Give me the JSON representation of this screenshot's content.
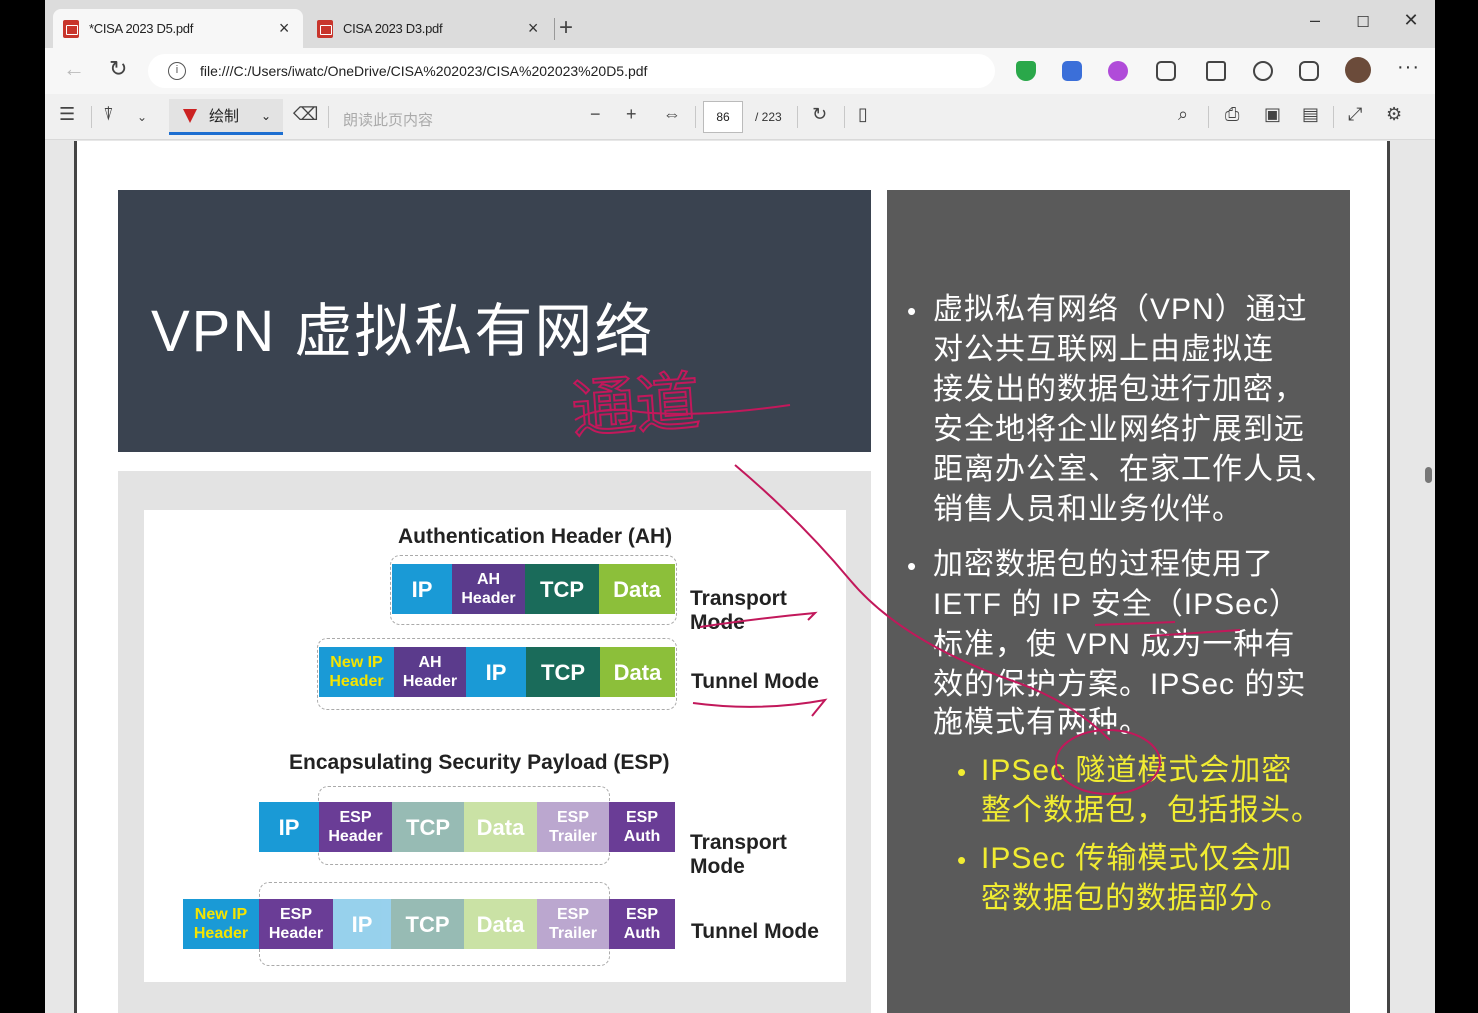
{
  "browser": {
    "tabs": [
      {
        "title": "*CISA 2023 D5.pdf",
        "close": "×"
      },
      {
        "title": "CISA 2023 D3.pdf",
        "close": "×"
      }
    ],
    "new_tab": "+",
    "window_controls": [
      "–",
      "☐",
      "✕"
    ],
    "url": "file:///C:/Users/iwatc/OneDrive/CISA%202023/CISA%202023%20D5.pdf",
    "info_glyph": "i",
    "more": "···"
  },
  "pdf_toolbar": {
    "draw_label": "绘制",
    "read_aloud": "朗读此页内容",
    "zoom_out": "−",
    "zoom_in": "+",
    "page_current": "86",
    "page_total": "/ 223"
  },
  "slide": {
    "title": "VPN 虚拟私有网络",
    "annotation_handwriting": "通道",
    "bullet1_lines": [
      "虚拟私有网络（VPN）通过",
      "对公共互联网上由虚拟连",
      "接发出的数据包进行加密，",
      "安全地将企业网络扩展到远",
      "距离办公室、在家工作人员、",
      "销售人员和业务伙伴。"
    ],
    "bullet2_lines": [
      "加密数据包的过程使用了",
      "IETF 的 IP 安全（IPSec）",
      "标准，使 VPN 成为一种有",
      "效的保护方案。IPSec 的实",
      "施模式有两种。"
    ],
    "sub1_lines": [
      "IPSec 隧道模式会加密",
      "整个数据包，包括报头。"
    ],
    "sub2_lines": [
      "IPSec 传输模式仅会加",
      "密数据包的数据部分。"
    ],
    "diagram": {
      "ah_title": "Authentication Header (AH)",
      "esp_title": "Encapsulating Security Payload (ESP)",
      "transport_mode": "Transport Mode",
      "tunnel_mode": "Tunnel Mode",
      "seg_ip": "IP",
      "seg_ah_header": "AH Header",
      "seg_tcp": "TCP",
      "seg_data": "Data",
      "seg_new_ip_header": "New IP Header",
      "seg_esp_header": "ESP Header",
      "seg_esp_trailer": "ESP Trailer",
      "seg_esp_auth": "ESP Auth"
    }
  },
  "colors": {
    "ip": "#1a9ad6",
    "ah": "#5b3b8c",
    "tcp": "#1a6b5a",
    "data": "#8cbf3a",
    "newip": "#1a9ad6",
    "newip_text": "#f5e400",
    "esp": "#6a3d96",
    "ink": "#c2185b"
  }
}
